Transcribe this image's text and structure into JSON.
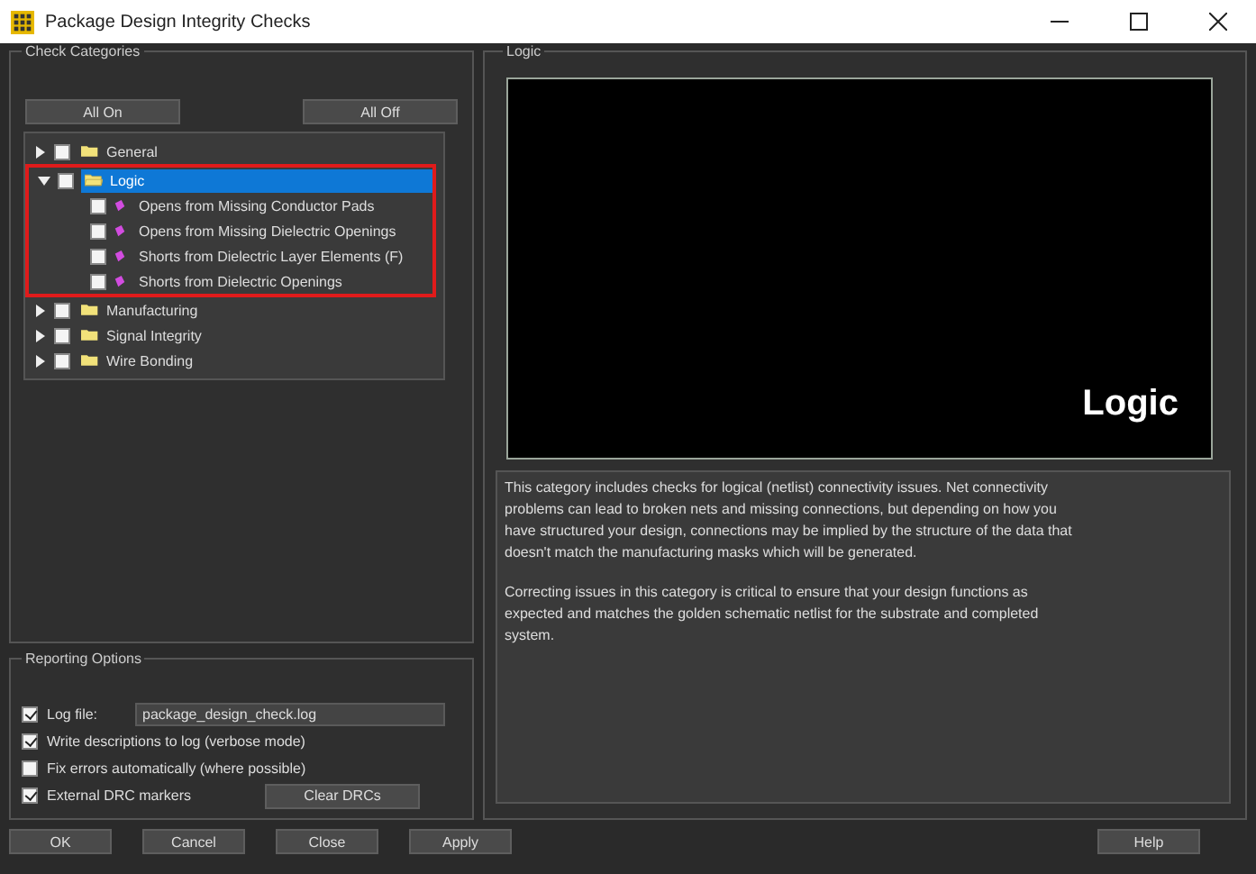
{
  "window": {
    "title": "Package Design Integrity Checks"
  },
  "categories": {
    "title": "Check Categories",
    "buttons": [
      "All On",
      "All Off"
    ],
    "tree": [
      {
        "label": "General",
        "expanded": false,
        "checked": false,
        "selected": false
      },
      {
        "label": "Logic",
        "expanded": true,
        "checked": false,
        "selected": true,
        "highlighted": true,
        "children": [
          {
            "label": "Opens from Missing Conductor Pads",
            "checked": false
          },
          {
            "label": "Opens from Missing Dielectric Openings",
            "checked": false
          },
          {
            "label": "Shorts from Dielectric Layer Elements (F)",
            "checked": false
          },
          {
            "label": "Shorts from Dielectric Openings",
            "checked": false
          }
        ]
      },
      {
        "label": "Manufacturing",
        "expanded": false,
        "checked": false,
        "selected": false
      },
      {
        "label": "Signal Integrity",
        "expanded": false,
        "checked": false,
        "selected": false
      },
      {
        "label": "Wire Bonding",
        "expanded": false,
        "checked": false,
        "selected": false
      }
    ]
  },
  "reporting": {
    "title": "Reporting Options",
    "options": [
      {
        "kind": "field",
        "label": "Log file:",
        "checked": true,
        "value": "package_design_check.log"
      },
      {
        "kind": "check",
        "label": "Write descriptions to log (verbose mode)",
        "checked": true
      },
      {
        "kind": "check",
        "label": "Fix errors automatically (where possible)",
        "checked": false
      },
      {
        "kind": "button",
        "label": "External DRC markers",
        "checked": true,
        "button": "Clear DRCs"
      }
    ]
  },
  "preview": {
    "title": "Logic",
    "label": "Logic",
    "description": [
      "This category includes checks for logical (netlist) connectivity issues. Net connectivity problems can lead to broken nets and missing connections, but depending on how you have structured your design, connections may be implied by the structure of the data that doesn't match the manufacturing masks which will be generated.",
      "Correcting issues in this category is critical to ensure that your design functions as expected and matches the golden schematic netlist for the substrate and completed system."
    ]
  },
  "buttons": [
    "OK",
    "Cancel",
    "Close",
    "Apply"
  ],
  "help": "Help"
}
